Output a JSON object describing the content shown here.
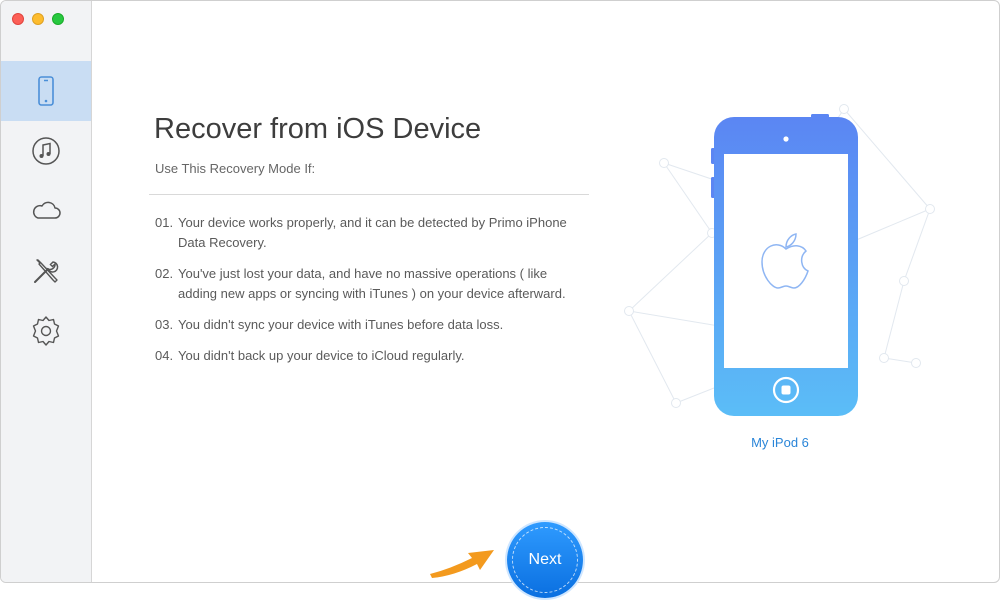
{
  "sidebar": {
    "items": [
      {
        "name": "ios-device",
        "icon": "iphone-icon",
        "active": true
      },
      {
        "name": "itunes",
        "icon": "music-note-icon",
        "active": false
      },
      {
        "name": "icloud",
        "icon": "cloud-icon",
        "active": false
      },
      {
        "name": "tools",
        "icon": "tools-icon",
        "active": false
      },
      {
        "name": "settings",
        "icon": "gear-icon",
        "active": false
      }
    ]
  },
  "main": {
    "title": "Recover from iOS Device",
    "subtitle": "Use This Recovery Mode If:",
    "reasons": [
      {
        "num": "01.",
        "text": "Your device works properly, and it can be detected by Primo iPhone Data Recovery."
      },
      {
        "num": "02.",
        "text": "You've just lost your data, and have no massive operations ( like adding new apps or syncing with iTunes ) on your device afterward."
      },
      {
        "num": "03.",
        "text": "You didn't sync your device with iTunes before data loss."
      },
      {
        "num": "04.",
        "text": "You didn't back up your device to iCloud regularly."
      }
    ],
    "device": {
      "name": "My iPod 6",
      "icon": "apple-logo-icon"
    }
  },
  "footer": {
    "next_label": "Next"
  },
  "colors": {
    "accent": "#2a85d8",
    "device_top": "#5b86f3",
    "device_bottom": "#5bbdf7",
    "arrow": "#f39a1e",
    "sidebar_active": "#c9ddf3"
  }
}
